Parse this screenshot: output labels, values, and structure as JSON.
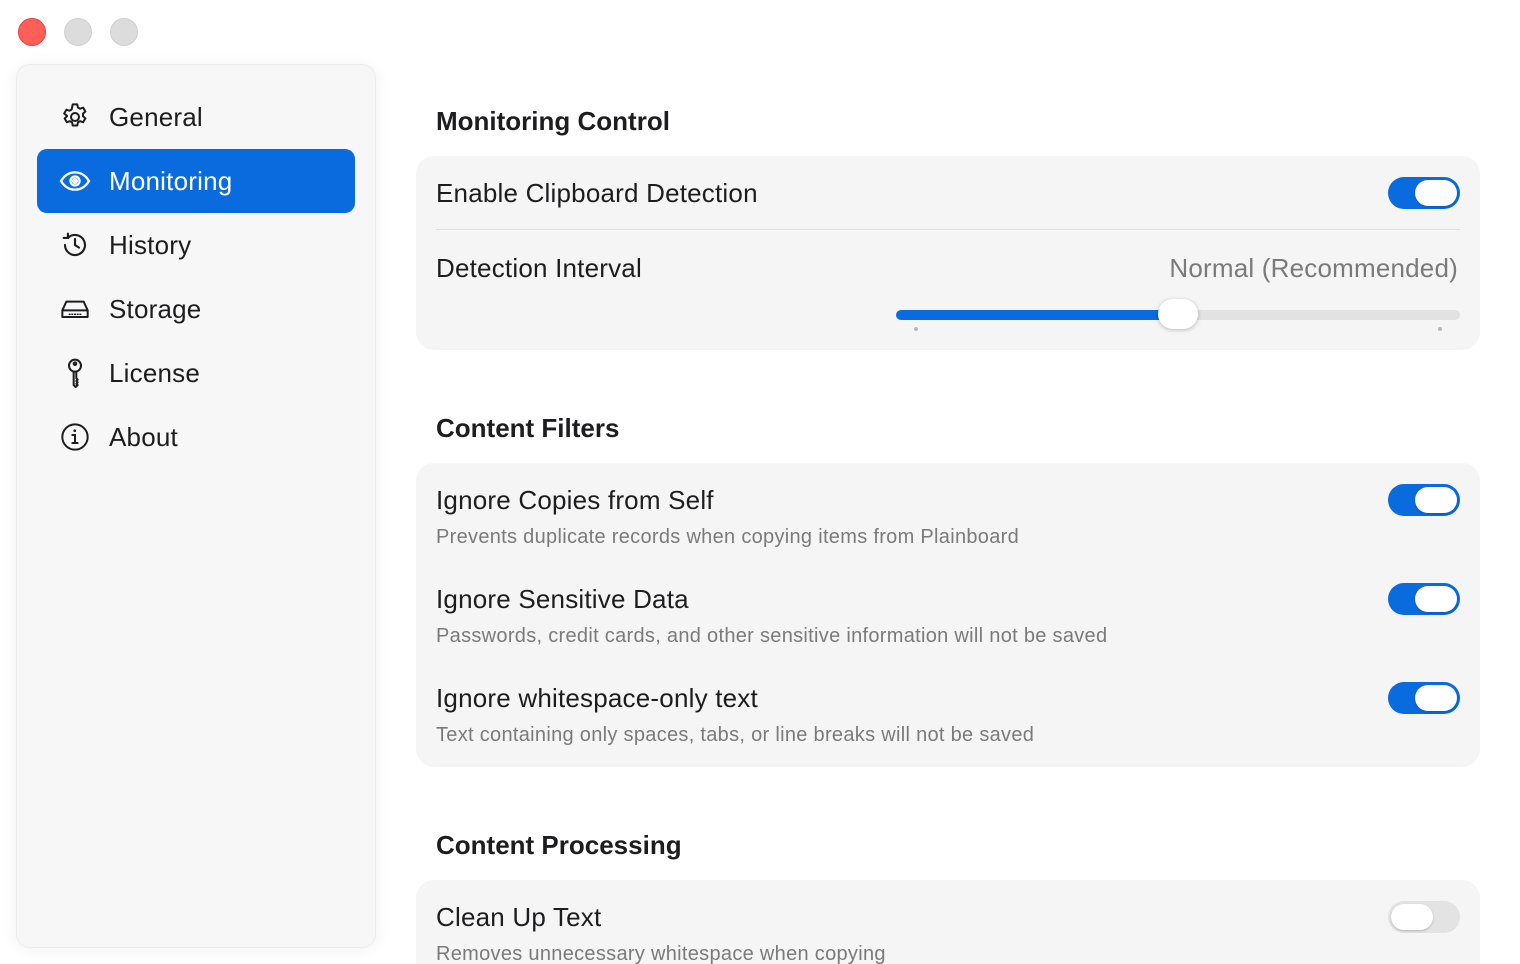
{
  "window": {
    "controls": [
      "close",
      "minimize",
      "maximize"
    ]
  },
  "sidebar": {
    "items": [
      {
        "label": "General",
        "icon": "gear-icon",
        "active": false
      },
      {
        "label": "Monitoring",
        "icon": "eye-icon",
        "active": true
      },
      {
        "label": "History",
        "icon": "history-icon",
        "active": false
      },
      {
        "label": "Storage",
        "icon": "storage-drive-icon",
        "active": false
      },
      {
        "label": "License",
        "icon": "key-icon",
        "active": false
      },
      {
        "label": "About",
        "icon": "info-icon",
        "active": false
      }
    ]
  },
  "monitoring_control": {
    "title": "Monitoring Control",
    "enable_detection": {
      "label": "Enable Clipboard Detection",
      "enabled": true
    },
    "detection_interval": {
      "label": "Detection Interval",
      "value": "Normal (Recommended)",
      "slider_fraction": 0.5
    }
  },
  "content_filters": {
    "title": "Content Filters",
    "items": [
      {
        "label": "Ignore Copies from Self",
        "description": "Prevents duplicate records when copying items from Plainboard",
        "enabled": true
      },
      {
        "label": "Ignore Sensitive Data",
        "description": "Passwords, credit cards, and other sensitive information will not be saved",
        "enabled": true
      },
      {
        "label": "Ignore whitespace-only text",
        "description": "Text containing only spaces, tabs, or line breaks will not be saved",
        "enabled": true
      }
    ]
  },
  "content_processing": {
    "title": "Content Processing",
    "items": [
      {
        "label": "Clean Up Text",
        "description": "Removes unnecessary whitespace when copying",
        "enabled": false
      }
    ]
  },
  "colors": {
    "accent": "#0a6bdf",
    "close_button": "#ff5f57"
  }
}
